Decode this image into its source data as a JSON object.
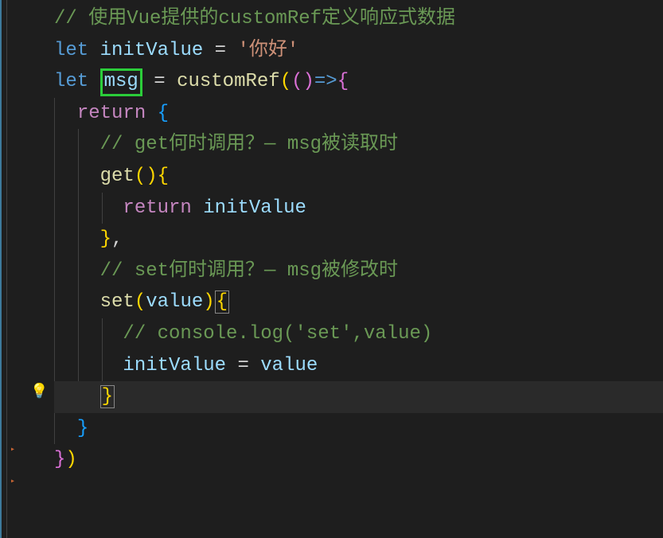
{
  "code": {
    "line1_comment": "// 使用Vue提供的customRef定义响应式数据",
    "line2": {
      "let": "let",
      "var": "initValue",
      "eq": " = ",
      "str": "'你好'"
    },
    "line3": {
      "let": "let",
      "var": "msg",
      "eq": " = ",
      "fn": "customRef",
      "paren1": "(",
      "paren2": "(",
      "paren3": ")",
      "arrow": "=>",
      "brace": "{"
    },
    "line4": {
      "return": "return",
      "brace": " {"
    },
    "line5_comment": "// get何时调用？— msg被读取时",
    "line6": {
      "fn": "get",
      "parens": "()",
      "brace": "{"
    },
    "line7": {
      "return": "return",
      "var": " initValue"
    },
    "line8": {
      "brace": "}",
      "comma": ","
    },
    "line9_comment": "// set何时调用？— msg被修改时",
    "line10": {
      "fn": "set",
      "paren1": "(",
      "param": "value",
      "paren2": ")",
      "brace": "{"
    },
    "line11_comment": "// console.log('set',value)",
    "line12": {
      "var1": "initValue",
      "eq": " = ",
      "var2": "value"
    },
    "line13_brace": "}",
    "line14_brace": "}",
    "line15": {
      "brace": "}",
      "paren": ")"
    }
  },
  "icons": {
    "lightbulb": "💡",
    "fold": "▸"
  }
}
